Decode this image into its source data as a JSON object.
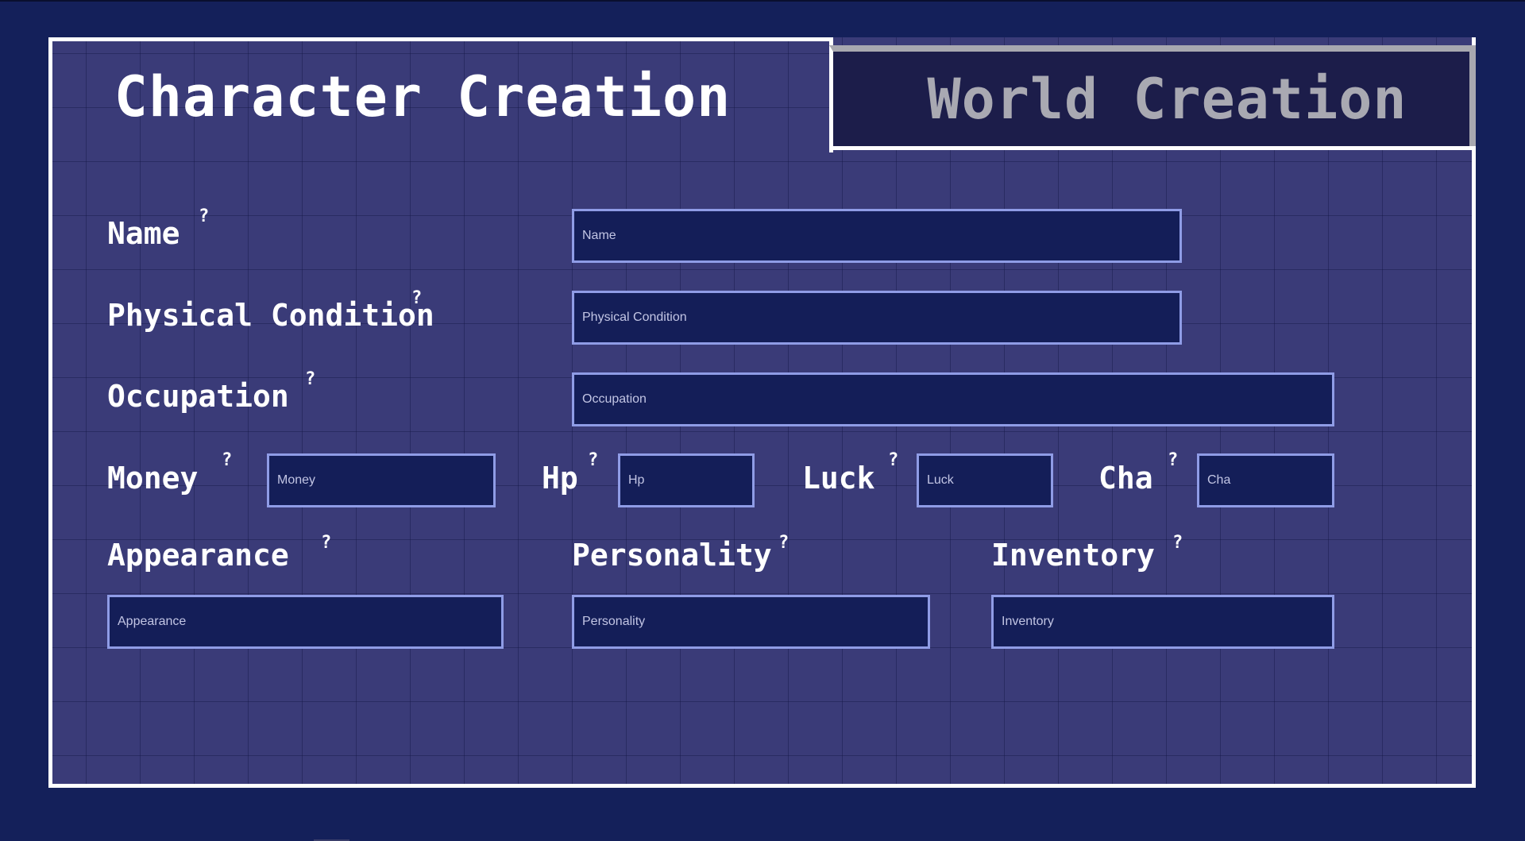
{
  "tabs": {
    "character": "Character Creation",
    "world": "World Creation"
  },
  "help_glyph": "?",
  "fields": {
    "name": {
      "label": "Name",
      "placeholder": "Name"
    },
    "physical_condition": {
      "label": "Physical Condition",
      "placeholder": "Physical Condition"
    },
    "occupation": {
      "label": "Occupation",
      "placeholder": "Occupation"
    },
    "money": {
      "label": "Money",
      "placeholder": "Money"
    },
    "hp": {
      "label": "Hp",
      "placeholder": "Hp"
    },
    "luck": {
      "label": "Luck",
      "placeholder": "Luck"
    },
    "cha": {
      "label": "Cha",
      "placeholder": "Cha"
    },
    "appearance": {
      "label": "Appearance",
      "placeholder": "Appearance"
    },
    "personality": {
      "label": "Personality",
      "placeholder": "Personality"
    },
    "inventory": {
      "label": "Inventory",
      "placeholder": "Inventory"
    }
  },
  "colors": {
    "background": "#14205a",
    "panel": "#3a3b78",
    "input_bg": "#141e58",
    "input_border": "#8f9ce6",
    "inactive_tab_bg": "#1c1d4a",
    "inactive_tab_text": "#a9a9b2",
    "text": "#ffffff"
  }
}
